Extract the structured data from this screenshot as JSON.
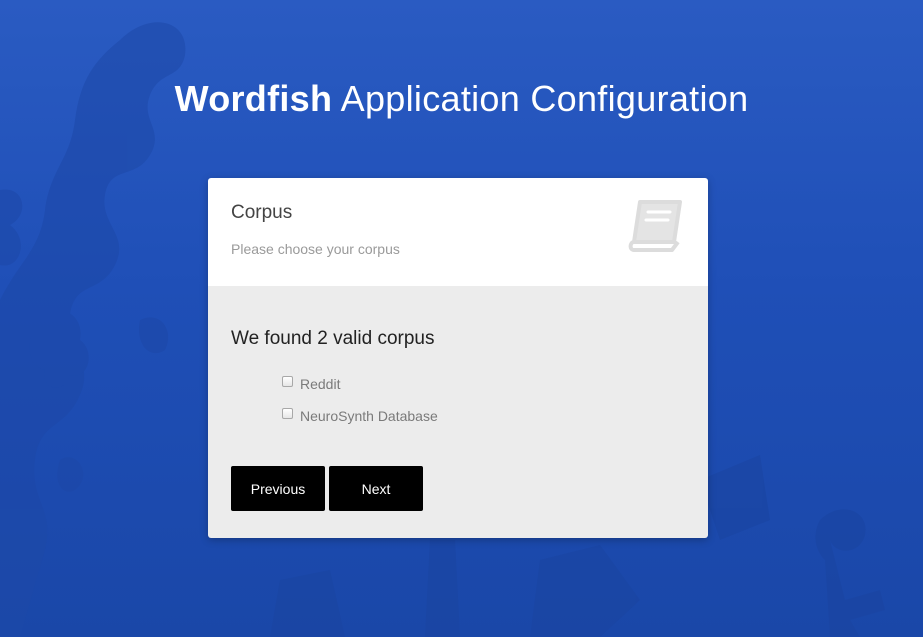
{
  "page": {
    "title_brand": "Wordfish",
    "title_rest": "Application Configuration"
  },
  "card": {
    "title": "Corpus",
    "subtitle": "Please choose your corpus",
    "icon": "book-icon",
    "found_text": "We found 2 valid corpus",
    "options": [
      {
        "label": "Reddit",
        "checked": false
      },
      {
        "label": "NeuroSynth Database",
        "checked": false
      }
    ],
    "buttons": {
      "previous": "Previous",
      "next": "Next"
    }
  },
  "colors": {
    "background": "#2a5bc2",
    "card_header": "#ffffff",
    "card_body": "#ececec",
    "button": "#000000"
  }
}
